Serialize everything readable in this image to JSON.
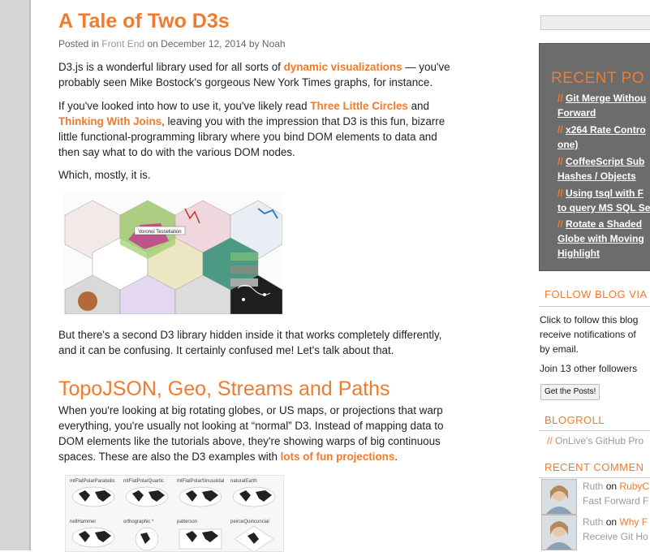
{
  "post": {
    "title": "A Tale of Two D3s",
    "meta": {
      "posted_in": "Posted in",
      "category": "Front End",
      "on": "on",
      "date": "December 12, 2014",
      "by": "by",
      "author": "Noah"
    },
    "p1": {
      "a": "D3.js is a wonderful library used for all sorts of ",
      "link": "dynamic visualizations",
      "b": " — you've",
      "c": "probably seen Mike Bostock's gorgeous New York Times graphs, for instance."
    },
    "p2": {
      "a": "If you've looked into how to use it, you've likely read ",
      "link1": "Three Little Circles",
      "b": " and",
      "link2": "Thinking With Joins",
      "c": ", leaving you with the impression that D3 is this fun, bizarre",
      "d": "little functional-programming library where you bind DOM elements to data and",
      "e": "then say what to do with the various DOM nodes."
    },
    "p3": "Which, mostly, it is.",
    "hex_label": "Voronoi Tessellation",
    "p4": {
      "a": "But there's a second D3 library hidden inside it that works completely differently,",
      "b": "and it can be confusing. It certainly confused me! Let's talk about that."
    },
    "h2": "TopoJSON, Geo, Streams and Paths",
    "p5": {
      "a": "When you're looking at big rotating globes, or US maps, or projections that warp",
      "b": "everything, you're usually not looking at “normal” D3. Instead of mapping data to",
      "c": "DOM elements like the tutorials above, they're showing warps of big continuous",
      "d": "spaces. These are also the D3 examples with ",
      "link": "lots of fun projections",
      "e": "."
    },
    "map_labels": [
      "mtFlatPolarParabolic",
      "mtFlatPolarQuartic",
      "mtFlatPolarSinusoidal",
      "naturalEarth",
      "nellHammer",
      "orthographic *",
      "patterson",
      "peirceQuincuncial"
    ]
  },
  "sidebar": {
    "recent_title": "RECENT PO",
    "recent_posts": [
      {
        "l1": "Git Merge Withou",
        "l2": "Forward"
      },
      {
        "l1": "x264 Rate Contro",
        "l2": "one)"
      },
      {
        "l1": "CoffeeScript Sub",
        "l2": "Hashes / Objects"
      },
      {
        "l1": "Using tsql with F",
        "l2": "to query MS SQL Se"
      },
      {
        "l1": "Rotate a Shaded",
        "l2": "Globe with Moving",
        "l3": "Highlight"
      }
    ],
    "follow_title": "FOLLOW BLOG VIA",
    "follow_text": [
      "Click to follow this blog",
      "receive notifications of",
      "by email."
    ],
    "followers": "Join 13 other followers",
    "follow_button": "Get the Posts!",
    "blogroll_title": "BLOGROLL",
    "blogroll_item": "OnLive's GitHub Pro",
    "comments_title": "RECENT COMMEN",
    "comments": [
      {
        "who": "Ruth",
        "on": "on",
        "post1": "RubyC",
        "post2": "Fast Forward F"
      },
      {
        "who": "Ruth",
        "on": "on",
        "post1": "Why F",
        "post2": "Receive Git Ho"
      }
    ]
  },
  "colors": {
    "accent": "#f07b2f",
    "sidebar_box": "#6c6c6c"
  }
}
